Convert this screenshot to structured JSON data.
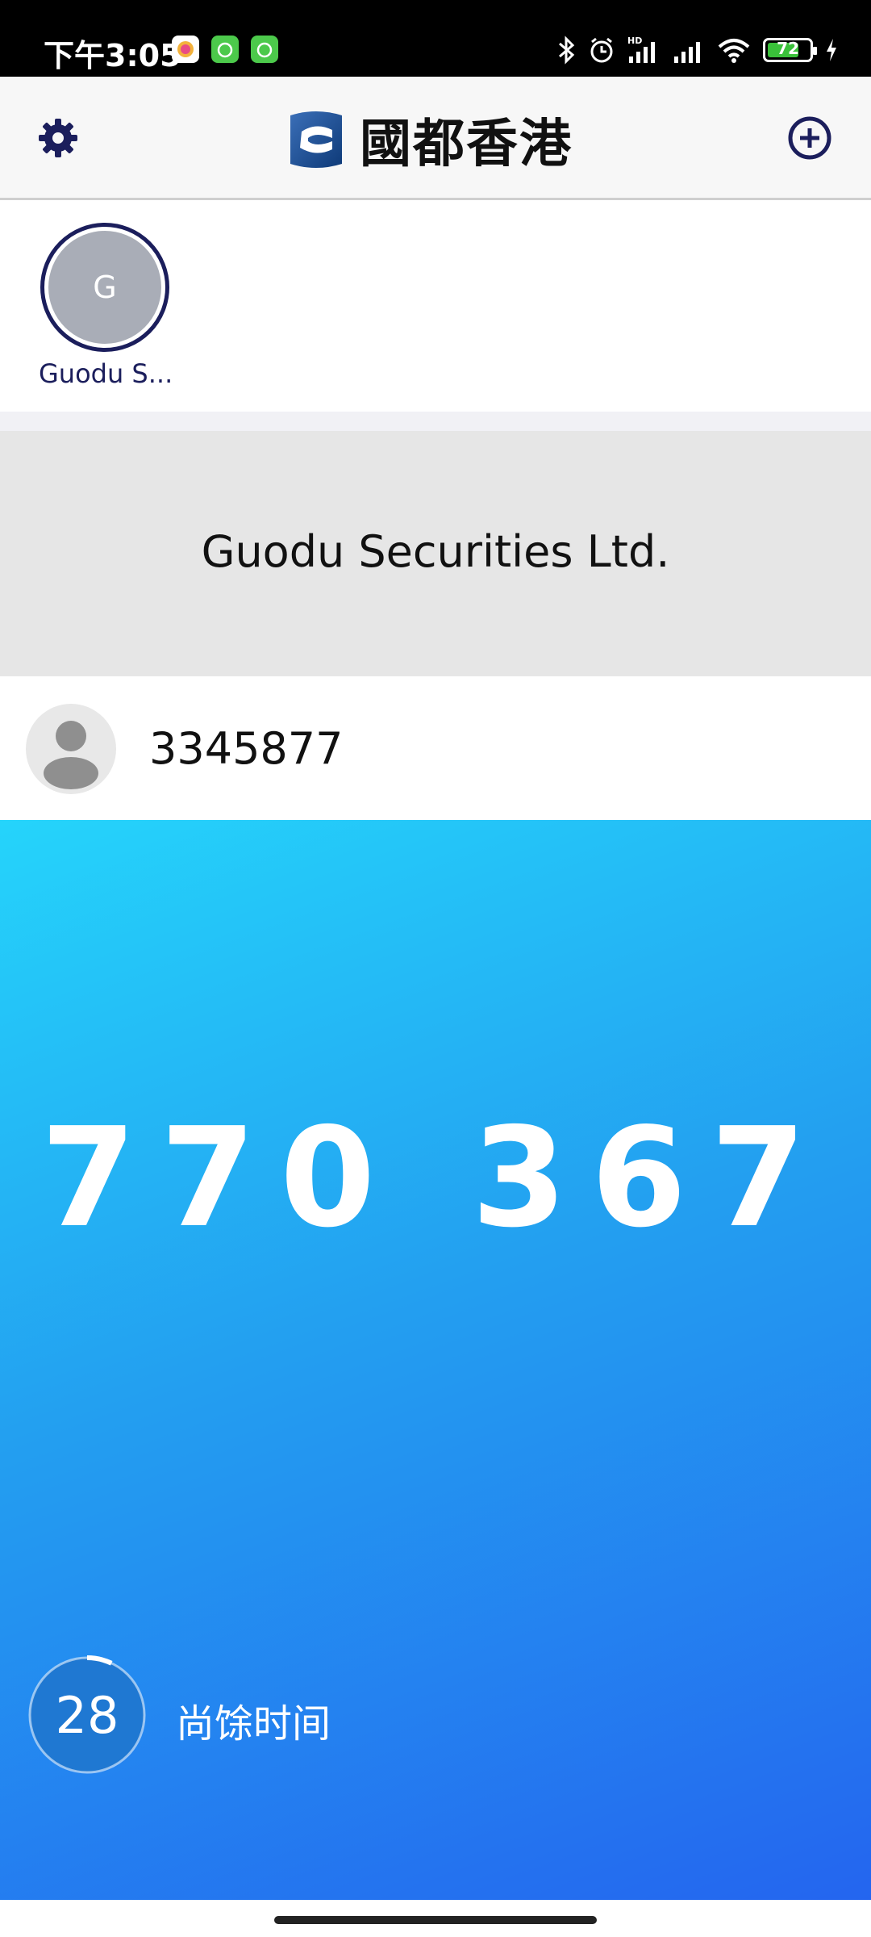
{
  "status_bar": {
    "time": "下午3:05",
    "battery_percent": "72",
    "icons": [
      "bluetooth-icon",
      "alarm-icon",
      "hd-signal-icon",
      "signal-icon",
      "wifi-icon",
      "battery-icon",
      "charging-icon"
    ]
  },
  "header": {
    "logo_text": "國都香港",
    "settings_icon": "gear-icon",
    "add_icon": "plus-circle-icon"
  },
  "account": {
    "initial": "G",
    "name": "Guodu S..."
  },
  "company": {
    "name": "Guodu Securities Ltd."
  },
  "user": {
    "id": "3345877"
  },
  "otp": {
    "code": "770 367",
    "remaining_seconds": "28",
    "remaining_label": "尚馀时间",
    "timer_progress": 0.93
  },
  "colors": {
    "brand_navy": "#1b1e5c",
    "otp_gradient_start": "#25d4fb",
    "otp_gradient_end": "#2465ef"
  }
}
